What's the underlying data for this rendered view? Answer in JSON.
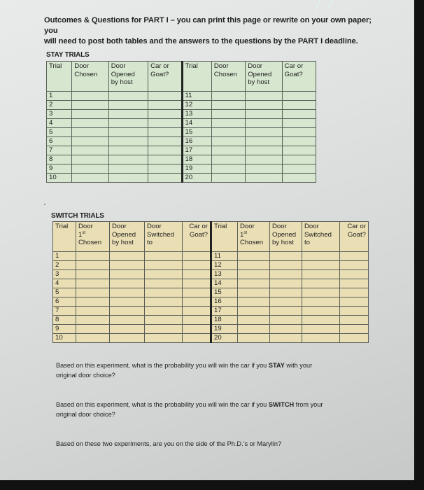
{
  "intro": {
    "line1": "Outcomes & Questions for PART I – you can print this page or rewrite on your own paper; you",
    "line2": "will need to post both tables and the answers to the questions by the PART I deadline."
  },
  "stay": {
    "title": "STAY TRIALS",
    "headers": {
      "trial": "Trial",
      "door_chosen": [
        "Door",
        "Chosen"
      ],
      "door_opened": [
        "Door",
        "Opened",
        "by host"
      ],
      "car_or_goat": [
        "Car or",
        "Goat?"
      ]
    },
    "trials_left": [
      "1",
      "2",
      "3",
      "4",
      "5",
      "6",
      "7",
      "8",
      "9",
      "10"
    ],
    "trials_right": [
      "11",
      "12",
      "13",
      "14",
      "15",
      "16",
      "17",
      "18",
      "19",
      "20"
    ]
  },
  "switch": {
    "title": "SWITCH TRIALS",
    "headers": {
      "trial": "Trial",
      "door_first": [
        "Door",
        "1",
        "st",
        "Chosen"
      ],
      "door_opened": [
        "Door",
        "Opened",
        "by host"
      ],
      "door_switched": [
        "Door",
        "Switched",
        "to"
      ],
      "car_or_goat": [
        "Car or",
        "Goat?"
      ]
    },
    "trials_left": [
      "1",
      "2",
      "3",
      "4",
      "5",
      "6",
      "7",
      "8",
      "9",
      "10"
    ],
    "trials_right": [
      "11",
      "12",
      "13",
      "14",
      "15",
      "16",
      "17",
      "18",
      "19",
      "20"
    ]
  },
  "questions": {
    "q1_pre": "Based on this experiment, what is the probability you will win the car if you ",
    "q1_bold": "STAY",
    "q1_post": " with your",
    "q1_line2": "original door choice?",
    "q2_pre": "Based on this experiment, what is the probability you will win the car if you ",
    "q2_bold": "SWITCH",
    "q2_post": " from your",
    "q2_line2": "original door choice?",
    "q3": "Based on these two experiments, are you on the side of the Ph.D.’s or Marylin?"
  },
  "colors": {
    "stay_table_bg": "#d6e6cf",
    "switch_table_bg": "#e9deb4"
  }
}
